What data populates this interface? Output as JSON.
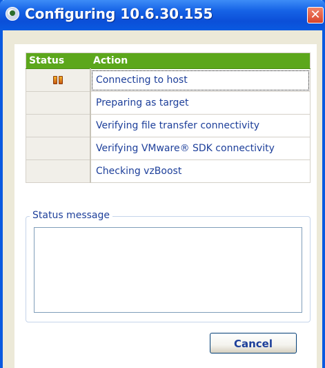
{
  "window": {
    "title": "Configuring 10.6.30.155",
    "close_label": "✕"
  },
  "grid": {
    "headers": {
      "status": "Status",
      "action": "Action"
    },
    "rows": [
      {
        "action": "Connecting to host",
        "status_icon": "pause-icon"
      },
      {
        "action": "Preparing as target",
        "status_icon": ""
      },
      {
        "action": "Verifying file transfer connectivity",
        "status_icon": ""
      },
      {
        "action": "Verifying VMware® SDK connectivity",
        "status_icon": ""
      },
      {
        "action": "Checking vzBoost",
        "status_icon": ""
      }
    ]
  },
  "status_group": {
    "legend": "Status message",
    "message": ""
  },
  "buttons": {
    "cancel": "Cancel"
  },
  "colors": {
    "title_bar": "#0a5ae0",
    "header_green": "#5ca71c",
    "text_blue": "#1d3f9a"
  }
}
